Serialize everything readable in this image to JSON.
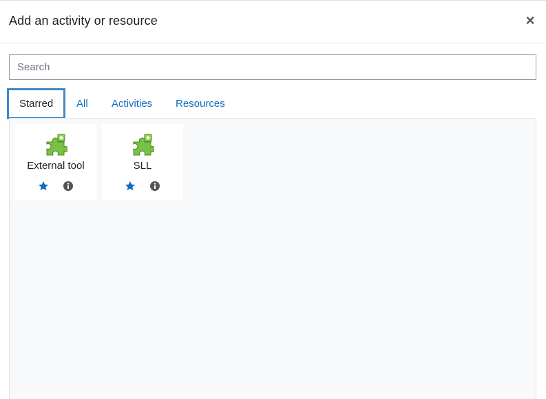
{
  "header": {
    "title": "Add an activity or resource",
    "close_symbol": "×"
  },
  "search": {
    "placeholder": "Search",
    "value": ""
  },
  "tabs": [
    {
      "label": "Starred",
      "active": true
    },
    {
      "label": "All",
      "active": false
    },
    {
      "label": "Activities",
      "active": false
    },
    {
      "label": "Resources",
      "active": false
    }
  ],
  "cards": [
    {
      "name": "External tool",
      "icon": "puzzle-piece-icon",
      "starred": true
    },
    {
      "name": "SLL",
      "icon": "puzzle-piece-icon",
      "starred": true
    }
  ],
  "colors": {
    "link": "#0f6cbf",
    "star": "#0f6cbf",
    "tab_focus_border": "#3f88c5",
    "puzzle_green": "#7ac143"
  }
}
